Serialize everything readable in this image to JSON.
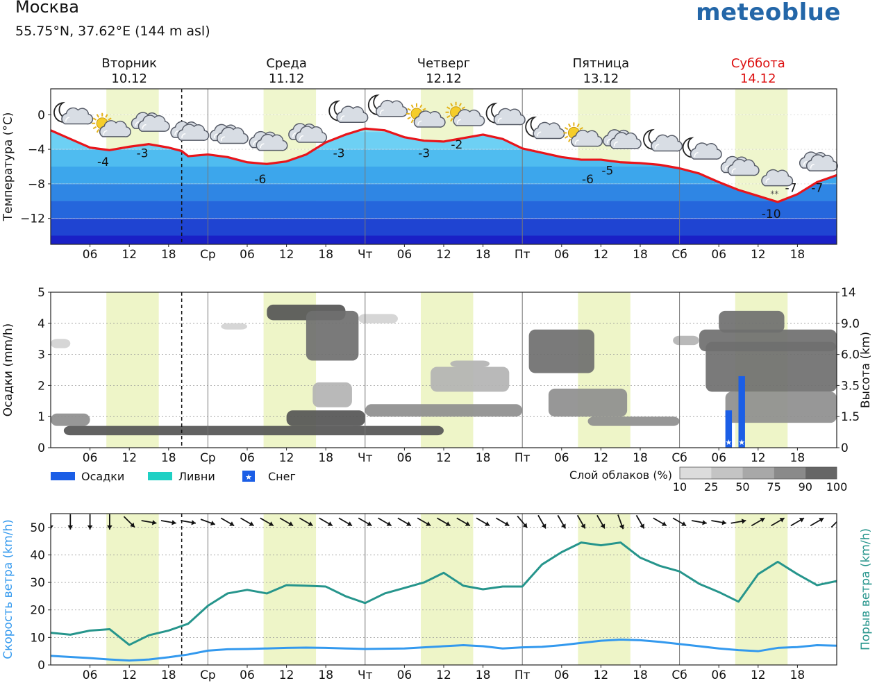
{
  "header": {
    "city": "Москва",
    "coords": "55.75°N, 37.62°E (144 m asl)",
    "brand": "meteoblue"
  },
  "days": [
    {
      "name": "Вторник",
      "date": "10.12",
      "abbr": "",
      "weekend": false
    },
    {
      "name": "Среда",
      "date": "11.12",
      "abbr": "Ср",
      "weekend": false
    },
    {
      "name": "Четверг",
      "date": "12.12",
      "abbr": "Чт",
      "weekend": false
    },
    {
      "name": "Пятница",
      "date": "13.12",
      "abbr": "Пт",
      "weekend": false
    },
    {
      "name": "Суббота",
      "date": "14.12",
      "abbr": "Сб",
      "weekend": true
    }
  ],
  "hour_ticks": [
    "06",
    "12",
    "18"
  ],
  "colors": {
    "temp_line": "#e8151b",
    "daylight_band": "#eef5c8",
    "precip_bar": "#1b5ee6",
    "wind_speed": "#3399ee",
    "wind_gust": "#26958c",
    "weekend": "#dd1111",
    "brand": "#2366a8"
  },
  "chart_data": [
    {
      "type": "area",
      "name": "temperature",
      "ylabel": "Температура (°C)",
      "ylim": [
        -15,
        3
      ],
      "yticks": [
        0,
        -4,
        -8,
        -12
      ],
      "x_unit": "hours from 10.12 00:00",
      "x": [
        0,
        3,
        6,
        9,
        12,
        15,
        18,
        20,
        21,
        24,
        27,
        30,
        33,
        36,
        39,
        42,
        45,
        48,
        51,
        54,
        57,
        60,
        63,
        66,
        69,
        72,
        75,
        78,
        81,
        84,
        87,
        90,
        93,
        96,
        99,
        102,
        105,
        108,
        111,
        114,
        117,
        120
      ],
      "y": [
        -1.8,
        -2.8,
        -3.8,
        -4.1,
        -3.7,
        -3.4,
        -3.8,
        -4.2,
        -4.8,
        -4.6,
        -4.9,
        -5.5,
        -5.7,
        -5.4,
        -4.6,
        -3.2,
        -2.3,
        -1.6,
        -1.8,
        -2.6,
        -3.0,
        -3.1,
        -2.7,
        -2.3,
        -2.8,
        -3.9,
        -4.4,
        -4.9,
        -5.2,
        -5.2,
        -5.5,
        -5.6,
        -5.8,
        -6.2,
        -6.8,
        -7.8,
        -8.7,
        -9.4,
        -10.1,
        -9.2,
        -7.8,
        -7.0
      ],
      "labels": [
        {
          "x": 8,
          "y": -4,
          "text": "-4"
        },
        {
          "x": 14,
          "y": -3,
          "text": "-3"
        },
        {
          "x": 32,
          "y": -6,
          "text": "-6"
        },
        {
          "x": 44,
          "y": -3,
          "text": "-3"
        },
        {
          "x": 57,
          "y": -3,
          "text": "-3"
        },
        {
          "x": 62,
          "y": -2,
          "text": "-2"
        },
        {
          "x": 82,
          "y": -6,
          "text": "-6"
        },
        {
          "x": 85,
          "y": -5,
          "text": "-5"
        },
        {
          "x": 110,
          "y": -10,
          "text": "-10"
        },
        {
          "x": 113,
          "y": -7,
          "text": "-7"
        },
        {
          "x": 117,
          "y": -7,
          "text": "-7"
        }
      ],
      "icons": [
        {
          "x": 2.5,
          "kind": "moon-cloud"
        },
        {
          "x": 8.5,
          "kind": "sun-cloud"
        },
        {
          "x": 14.5,
          "kind": "cloud"
        },
        {
          "x": 20.5,
          "kind": "cloud"
        },
        {
          "x": 26.5,
          "kind": "cloud"
        },
        {
          "x": 32.5,
          "kind": "cloud"
        },
        {
          "x": 38.5,
          "kind": "cloud"
        },
        {
          "x": 44.5,
          "kind": "moon-cloud"
        },
        {
          "x": 50.5,
          "kind": "moon-cloud"
        },
        {
          "x": 56.5,
          "kind": "sun-cloud"
        },
        {
          "x": 62.5,
          "kind": "sun-cloud"
        },
        {
          "x": 68.5,
          "kind": "moon-cloud"
        },
        {
          "x": 74.5,
          "kind": "moon-cloud"
        },
        {
          "x": 80.5,
          "kind": "sun-cloud"
        },
        {
          "x": 86.5,
          "kind": "cloud"
        },
        {
          "x": 92.5,
          "kind": "moon-cloud"
        },
        {
          "x": 98.5,
          "kind": "moon-cloud"
        },
        {
          "x": 104.5,
          "kind": "cloud"
        },
        {
          "x": 110.5,
          "kind": "snow-cloud"
        },
        {
          "x": 116.5,
          "kind": "cloud"
        }
      ]
    },
    {
      "type": "heatmap",
      "name": "precipitation-and-clouds",
      "ylabel_left": "Осадки (mm/h)",
      "ylabel_right": "Высота (km)",
      "ylim_left": [
        0,
        5
      ],
      "yticks_left": [
        0,
        1,
        2,
        3,
        4,
        5
      ],
      "yticks_right": [
        "0",
        "1.5",
        "3.5",
        "6.0",
        "9.0",
        "14"
      ],
      "precip_bars": [
        {
          "x": 103.5,
          "value": 1.2,
          "snow": true
        },
        {
          "x": 105.5,
          "value": 2.3,
          "snow": true
        }
      ],
      "cloud_blobs": [
        {
          "x": 0,
          "w": 6,
          "alt": 0.7,
          "h": 0.4,
          "cover": 75
        },
        {
          "x": 2,
          "w": 58,
          "alt": 0.4,
          "h": 0.3,
          "cover": 100
        },
        {
          "x": 0,
          "w": 3,
          "alt": 3.2,
          "h": 0.3,
          "cover": 25
        },
        {
          "x": 26,
          "w": 4,
          "alt": 3.8,
          "h": 0.2,
          "cover": 25
        },
        {
          "x": 33,
          "w": 12,
          "alt": 4.1,
          "h": 0.5,
          "cover": 100
        },
        {
          "x": 39,
          "w": 8,
          "alt": 2.8,
          "h": 1.6,
          "cover": 90
        },
        {
          "x": 40,
          "w": 6,
          "alt": 1.3,
          "h": 0.8,
          "cover": 50
        },
        {
          "x": 36,
          "w": 12,
          "alt": 0.7,
          "h": 0.5,
          "cover": 100
        },
        {
          "x": 47,
          "w": 6,
          "alt": 4.0,
          "h": 0.3,
          "cover": 25
        },
        {
          "x": 48,
          "w": 24,
          "alt": 1.0,
          "h": 0.4,
          "cover": 75
        },
        {
          "x": 61,
          "w": 6,
          "alt": 2.6,
          "h": 0.2,
          "cover": 50
        },
        {
          "x": 58,
          "w": 12,
          "alt": 1.8,
          "h": 0.8,
          "cover": 50
        },
        {
          "x": 73,
          "w": 10,
          "alt": 2.4,
          "h": 1.4,
          "cover": 90
        },
        {
          "x": 76,
          "w": 12,
          "alt": 1.0,
          "h": 0.9,
          "cover": 75
        },
        {
          "x": 82,
          "w": 14,
          "alt": 0.7,
          "h": 0.3,
          "cover": 75
        },
        {
          "x": 95,
          "w": 4,
          "alt": 3.3,
          "h": 0.3,
          "cover": 50
        },
        {
          "x": 99,
          "w": 21,
          "alt": 3.1,
          "h": 0.7,
          "cover": 90
        },
        {
          "x": 102,
          "w": 10,
          "alt": 3.7,
          "h": 0.7,
          "cover": 90
        },
        {
          "x": 100,
          "w": 20,
          "alt": 1.8,
          "h": 1.6,
          "cover": 90
        },
        {
          "x": 103,
          "w": 17,
          "alt": 0.8,
          "h": 1.0,
          "cover": 75
        }
      ],
      "legend": {
        "precip": "Осадки",
        "showers": "Ливни",
        "snow": "Снег",
        "cloud_title": "Слой облаков (%)",
        "cloud_steps": [
          "10",
          "25",
          "50",
          "75",
          "90",
          "100"
        ]
      }
    },
    {
      "type": "line",
      "name": "wind",
      "ylabel_left": "Скорость ветра (km/h)",
      "ylabel_right": "Порыв ветра (km/h)",
      "ylim": [
        0,
        55
      ],
      "yticks": [
        0,
        10,
        20,
        30,
        40,
        50
      ],
      "x": [
        0,
        3,
        6,
        9,
        12,
        15,
        18,
        21,
        24,
        27,
        30,
        33,
        36,
        39,
        42,
        45,
        48,
        51,
        54,
        57,
        60,
        63,
        66,
        69,
        72,
        75,
        78,
        81,
        84,
        87,
        90,
        93,
        96,
        99,
        102,
        105,
        108,
        111,
        114,
        117,
        120
      ],
      "series": [
        {
          "name": "Скорость ветра (km/h)",
          "values": [
            3.3,
            2.9,
            2.5,
            2.0,
            1.6,
            2.0,
            2.8,
            3.8,
            5.2,
            5.7,
            5.8,
            6.0,
            6.2,
            6.3,
            6.2,
            6.0,
            5.8,
            5.9,
            6.0,
            6.4,
            6.8,
            7.2,
            6.8,
            6.0,
            6.4,
            6.6,
            7.2,
            8.0,
            8.8,
            9.2,
            9.0,
            8.4,
            7.6,
            6.8,
            6.0,
            5.4,
            5.0,
            6.2,
            6.5,
            7.2,
            7.0
          ]
        },
        {
          "name": "Порыв ветра (km/h)",
          "values": [
            11.7,
            11.0,
            12.5,
            13.0,
            7.3,
            10.8,
            12.5,
            15.0,
            21.5,
            26.0,
            27.3,
            26.0,
            29.0,
            28.8,
            28.5,
            25.0,
            22.5,
            26.0,
            28.0,
            30.0,
            33.5,
            28.8,
            27.5,
            28.5,
            28.5,
            36.5,
            41.0,
            44.5,
            43.5,
            44.5,
            39.0,
            36.0,
            34.0,
            29.5,
            26.5,
            23.0,
            33.0,
            37.5,
            33.0,
            29.0,
            30.5
          ]
        }
      ],
      "arrows_deg": [
        180,
        180,
        180,
        180,
        135,
        100,
        100,
        100,
        110,
        120,
        120,
        120,
        120,
        120,
        120,
        120,
        120,
        120,
        120,
        120,
        120,
        120,
        120,
        120,
        140,
        150,
        150,
        150,
        150,
        160,
        150,
        120,
        120,
        100,
        100,
        80,
        60,
        60,
        60,
        60,
        45
      ]
    }
  ]
}
